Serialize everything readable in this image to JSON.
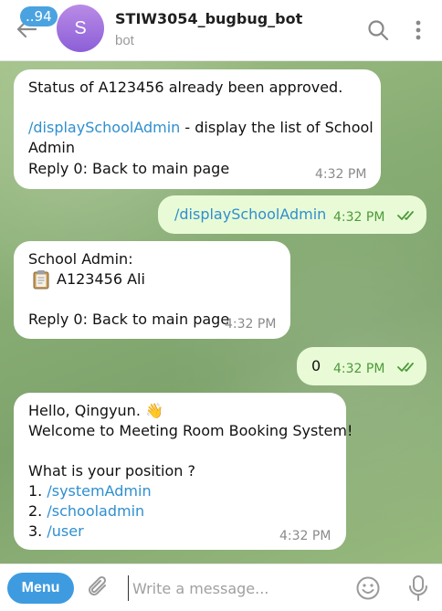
{
  "header": {
    "unread_count": "..94",
    "avatar_letter": "S",
    "title": "STIW3054_bugbug_bot",
    "subtitle": "bot"
  },
  "messages": [
    {
      "lines": [
        "Status of A123456 already been approved.",
        "",
        "/displaySchoolAdmin",
        " - display the list of School",
        "Admin",
        " Reply 0: Back to main page"
      ],
      "time": "4:32 PM"
    },
    {
      "text": "/displaySchoolAdmin",
      "time": "4:32 PM"
    },
    {
      "lines": [
        "School Admin:",
        "A123456 Ali",
        "Reply 0: Back to main page"
      ],
      "time": "4:32 PM"
    },
    {
      "text": "0",
      "time": "4:32 PM"
    },
    {
      "lines": [
        "Hello, Qingyun. 👋",
        "Welcome to Meeting Room Booking System!",
        "What is your position ?",
        " 1. ",
        "/systemAdmin",
        " 2. ",
        "/schooladmin",
        " 3. ",
        "/user"
      ],
      "time": "4:32 PM"
    }
  ],
  "composer": {
    "menu_label": "Menu",
    "placeholder": "Write a message..."
  },
  "colors": {
    "accent": "#3f9be0",
    "link": "#2f8fcf",
    "outgoing_bubble": "#e9fbd6",
    "check": "#4c9a3a"
  },
  "icons": [
    "back-arrow-icon",
    "search-icon",
    "more-vert-icon",
    "clipboard-icon",
    "paperclip-icon",
    "emoji-icon",
    "microphone-icon",
    "double-check-icon"
  ]
}
